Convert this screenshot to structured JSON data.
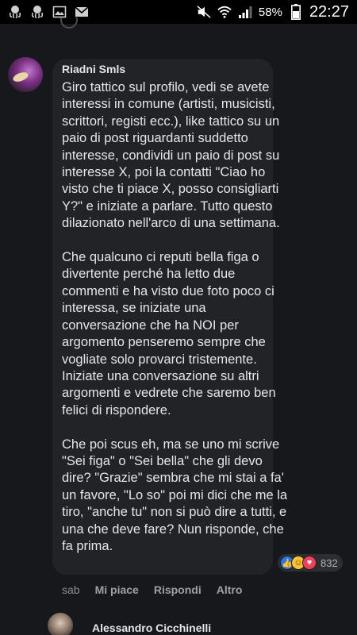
{
  "status_bar": {
    "battery_percent": "58%",
    "time": "22:27",
    "left_icons": [
      "octopus-icon",
      "octopus-icon",
      "image-icon",
      "gmail-icon"
    ],
    "right_icons": [
      "mute-icon",
      "wifi-icon",
      "signal-icon",
      "battery-icon"
    ]
  },
  "comment": {
    "author": "Riadni Smls",
    "text": "Giro tattico sul profilo, vedi se avete interessi in comune (artisti, musicisti, scrittori, registi ecc.), like tattico su un paio di post riguardanti suddetto interesse, condividi un paio di post su interesse X, poi la contatti \"Ciao ho visto che ti piace X, posso consigliarti Y?\" e iniziate a parlare. Tutto questo dilazionato nell'arco di una settimana.\n\nChe qualcuno ci reputi bella figa o divertente perché ha letto due commenti e ha visto due foto poco ci interessa, se iniziate una conversazione che ha NOI per argomento penseremo sempre che vogliate solo provarci tristemente. Iniziate una conversazione su altri argomenti e vedrete che saremo ben felici di rispondere.\n\nChe poi scus eh, ma se uno mi scrive \"Sei figa\" o \"Sei bella\" che gli devo dire? \"Grazie\" sembra che mi stai a fa' un favore, \"Lo so\" poi mi dici che me la tiro, \"anche tu\" non si può dire a tutti, e una che deve fare? Nun risponde, che fa prima.",
    "reactions": {
      "icons": [
        "like-icon",
        "haha-icon",
        "love-icon"
      ],
      "count": "832",
      "colors": {
        "like": "#2078f4",
        "haha": "#f7c434",
        "love": "#f33e58"
      }
    },
    "actions": {
      "time": "sab",
      "like": "Mi piace",
      "reply": "Rispondi",
      "more": "Altro"
    }
  },
  "next_comment": {
    "author": "Alessandro Cicchinelli"
  }
}
